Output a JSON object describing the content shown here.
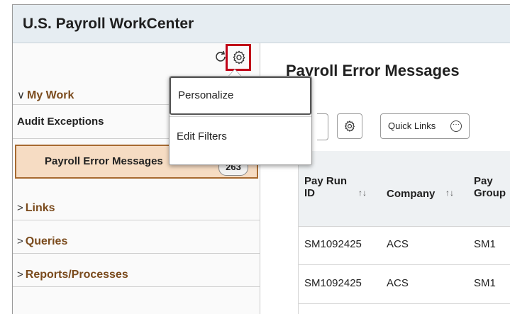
{
  "app": {
    "title": "U.S. Payroll WorkCenter"
  },
  "left": {
    "my_work": "My Work",
    "audit_exceptions": "Audit Exceptions",
    "payroll_error_messages": "Payroll Error Messages",
    "payroll_error_count": "263",
    "links": "Links",
    "queries": "Queries",
    "reports": "Reports/Processes",
    "icons": {
      "refresh": "refresh-icon",
      "settings": "gear-icon"
    }
  },
  "menu": {
    "items": [
      "Personalize",
      "Edit Filters"
    ]
  },
  "main": {
    "page_title": "Payroll Error Messages",
    "quick_links": "Quick Links",
    "columns": [
      "Pay Run ID",
      "Company",
      "Pay Group"
    ],
    "rows": [
      [
        "SM1092425",
        "ACS",
        "SM1"
      ],
      [
        "SM1092425",
        "ACS",
        "SM1"
      ]
    ]
  },
  "colors": {
    "highlight_border": "#c00018",
    "selected_row": "#f6dcc3",
    "section_label": "#7a4a1c"
  }
}
